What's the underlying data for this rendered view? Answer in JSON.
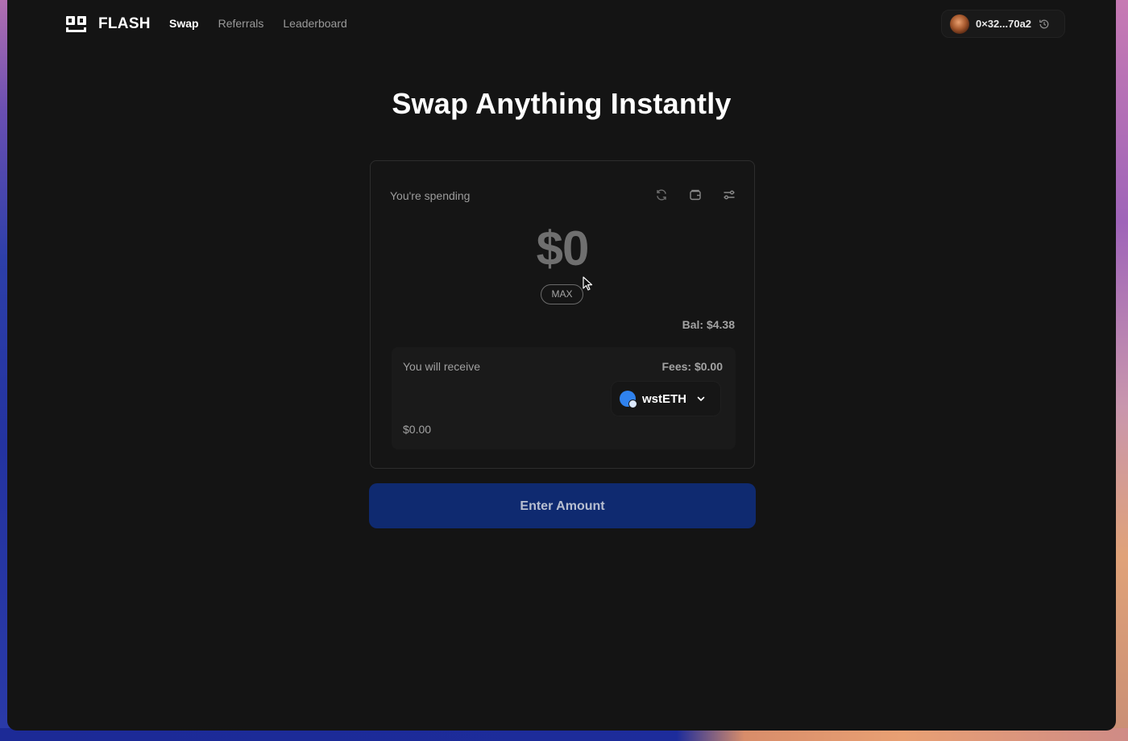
{
  "brand": {
    "name": "FLASH",
    "logo_icon": "flash-logo-icon"
  },
  "nav": {
    "items": [
      {
        "label": "Swap",
        "active": true
      },
      {
        "label": "Referrals",
        "active": false
      },
      {
        "label": "Leaderboard",
        "active": false
      }
    ]
  },
  "wallet": {
    "address": "0×32...70a2",
    "history_icon": "history-icon"
  },
  "hero": {
    "title": "Swap Anything Instantly"
  },
  "swap": {
    "spending_label": "You're spending",
    "toolbar_icons": [
      "refresh-icon",
      "wallet-icon",
      "settings-sliders-icon"
    ],
    "amount": "$0",
    "max_label": "MAX",
    "balance": "Bal: $4.38",
    "receive": {
      "label": "You will receive",
      "fees": "Fees: $0.00",
      "token": "wstETH",
      "usd_value": "$0.00"
    },
    "cta_label": "Enter Amount"
  },
  "colors": {
    "background": "#141414",
    "cta": "#0f2a70",
    "token_accent": "#2f82ef"
  }
}
